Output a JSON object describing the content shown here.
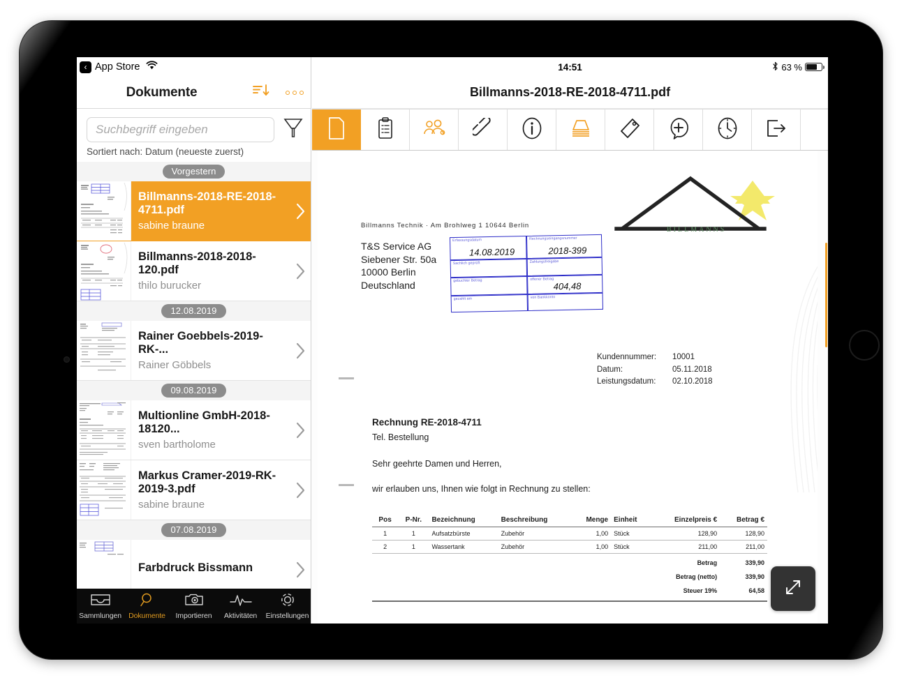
{
  "device": {
    "home_button": "home-button"
  },
  "sidebar": {
    "status": {
      "back_label": "App Store",
      "back_icon": "chevron-left-icon",
      "wifi_icon": "wifi-icon"
    },
    "title": "Dokumente",
    "sort_icon": "sort-descending-icon",
    "more_icon": "more-options-icon",
    "search": {
      "placeholder": "Suchbegriff eingeben",
      "value": ""
    },
    "filter_icon": "filter-funnel-icon",
    "sort_info": "Sortiert nach: Datum (neueste zuerst)",
    "list": [
      {
        "type": "separator",
        "label": "Vorgestern"
      },
      {
        "type": "doc",
        "title": "Billmanns-2018-RE-2018-4711.pdf",
        "author": "sabine braune",
        "selected": true
      },
      {
        "type": "doc",
        "title": "Billmanns-2018-2018-120.pdf",
        "author": "thilo burucker",
        "selected": false
      },
      {
        "type": "separator",
        "label": "12.08.2019"
      },
      {
        "type": "doc",
        "title": "Rainer Goebbels-2019-RK-...",
        "author": "Rainer Göbbels",
        "selected": false
      },
      {
        "type": "separator",
        "label": "09.08.2019"
      },
      {
        "type": "doc",
        "title": "Multionline GmbH-2018-18120...",
        "author": "sven bartholome",
        "selected": false
      },
      {
        "type": "doc",
        "title": "Markus Cramer-2019-RK-2019-3.pdf",
        "author": "sabine braune",
        "selected": false
      },
      {
        "type": "separator",
        "label": "07.08.2019"
      },
      {
        "type": "doc",
        "title": "Farbdruck Bissmann",
        "author": "",
        "selected": false
      }
    ],
    "tabs": [
      {
        "label": "Sammlungen",
        "icon": "inbox-tray-icon",
        "active": false
      },
      {
        "label": "Dokumente",
        "icon": "magnifier-icon",
        "active": true
      },
      {
        "label": "Importieren",
        "icon": "camera-icon",
        "active": false
      },
      {
        "label": "Aktivitäten",
        "icon": "pulse-activity-icon",
        "active": false
      },
      {
        "label": "Einstellungen",
        "icon": "gear-icon",
        "active": false
      }
    ]
  },
  "main": {
    "status": {
      "time": "14:51",
      "bluetooth_icon": "bluetooth-icon",
      "battery_percent": "63 %",
      "battery_icon": "battery-icon"
    },
    "title": "Billmanns-2018-RE-2018-4711.pdf",
    "toolbar": [
      {
        "name": "document",
        "icon": "document-page-icon",
        "state": "active"
      },
      {
        "name": "form",
        "icon": "clipboard-checklist-icon",
        "state": "normal"
      },
      {
        "name": "contacts",
        "icon": "people-group-icon",
        "state": "accent"
      },
      {
        "name": "link",
        "icon": "paperclip-link-icon",
        "state": "normal"
      },
      {
        "name": "info",
        "icon": "info-circle-icon",
        "state": "normal"
      },
      {
        "name": "stack",
        "icon": "layers-stack-icon",
        "state": "accent"
      },
      {
        "name": "tag",
        "icon": "tag-label-icon",
        "state": "normal"
      },
      {
        "name": "comment",
        "icon": "add-comment-icon",
        "state": "normal"
      },
      {
        "name": "history",
        "icon": "clock-history-icon",
        "state": "normal"
      },
      {
        "name": "export",
        "icon": "export-arrow-icon",
        "state": "normal"
      }
    ],
    "expand_icon": "expand-diagonal-icon"
  },
  "pdf": {
    "sender_line": "Billmanns Technik · Am Brohlweg 1   10644 Berlin",
    "recipient": [
      "T&S Service AG",
      "Siebener Str. 50a",
      "10000 Berlin",
      "Deutschland"
    ],
    "logo_text": "BILLMANNS",
    "stamp": {
      "fields": [
        {
          "label": "Erfassungsdatum",
          "value": "14.08.2019"
        },
        {
          "label": "Rechnungseingangsnummer",
          "value": "2018-399"
        },
        {
          "label": "Sachlich geprüft",
          "value": ""
        },
        {
          "label": "Zahlungsfreigabe",
          "value": ""
        },
        {
          "label": "gebuchter Betrag",
          "value": ""
        },
        {
          "label": "offener Betrag",
          "value": "404,48"
        },
        {
          "label": "gezahlt am",
          "value": ""
        },
        {
          "label": "von Bankkonto",
          "value": ""
        }
      ]
    },
    "customer": [
      {
        "key": "Kundennummer:",
        "value": "10001"
      },
      {
        "key": "Datum:",
        "value": "05.11.2018"
      },
      {
        "key": "Leistungsdatum:",
        "value": "02.10.2018"
      }
    ],
    "invoice_title": "Rechnung RE-2018-4711",
    "invoice_sub": "Tel. Bestellung",
    "salutation": "Sehr geehrte Damen und Herren,",
    "intro": "wir erlauben uns, Ihnen wie folgt in Rechnung zu stellen:",
    "table": {
      "headers": [
        "Pos",
        "P-Nr.",
        "Bezeichnung",
        "Beschreibung",
        "Menge",
        "Einheit",
        "Einzelpreis €",
        "Betrag €"
      ],
      "rows": [
        [
          "1",
          "1",
          "Aufsatzbürste",
          "Zubehör",
          "1,00",
          "Stück",
          "128,90",
          "128,90"
        ],
        [
          "2",
          "1",
          "Wassertank",
          "Zubehör",
          "1,00",
          "Stück",
          "211,00",
          "211,00"
        ]
      ],
      "totals": [
        {
          "label": "Betrag",
          "value": "339,90"
        },
        {
          "label": "Betrag (netto)",
          "value": "339,90"
        },
        {
          "label": "Steuer 19%",
          "value": "64,58"
        }
      ]
    }
  },
  "colors": {
    "accent": "#F2A024",
    "tabbar_bg": "#0b0b0b",
    "stamp_blue": "#2b2bc8",
    "logo_green": "#5f8f64",
    "star_yellow": "#f3e96b"
  }
}
